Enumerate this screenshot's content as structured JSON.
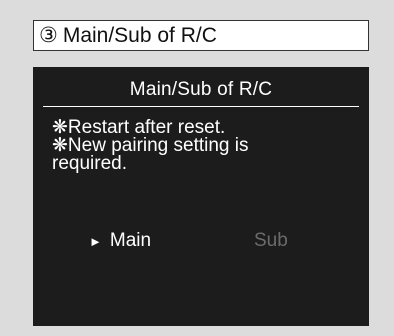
{
  "header": {
    "step_number": "③",
    "title": "Main/Sub of R/C"
  },
  "screen": {
    "title": "Main/Sub of R/C",
    "notes": [
      "❋Restart after reset.",
      "❋New pairing setting is",
      "required."
    ],
    "options": {
      "cursor": "►",
      "main_label": "Main",
      "sub_label": "Sub",
      "selected": "Main"
    },
    "colors": {
      "screen_background": "#1c1c1c",
      "text": "#ffffff",
      "inactive_option": "#6b6b6b"
    }
  }
}
